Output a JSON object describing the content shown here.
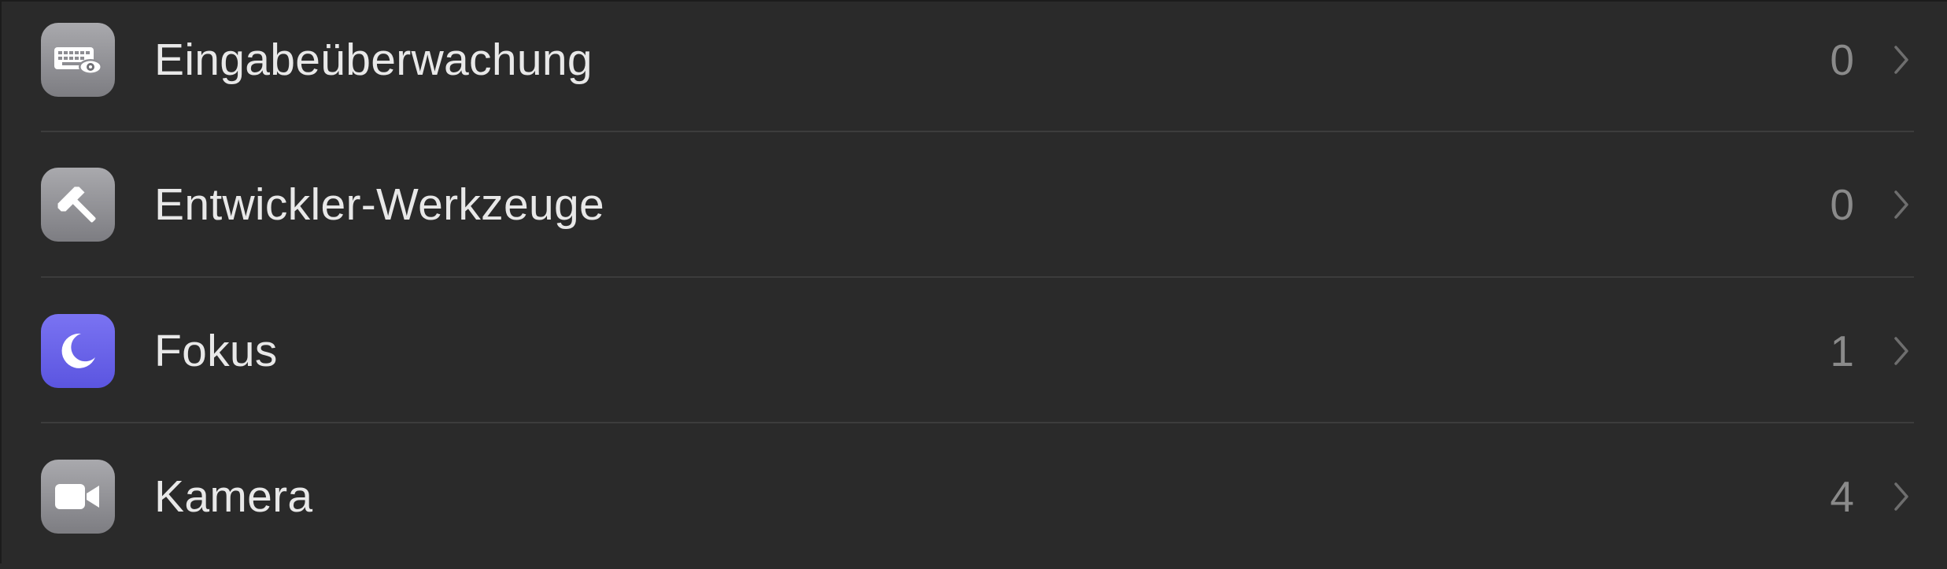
{
  "rows": [
    {
      "label": "Eingabeüberwachung",
      "count": "0",
      "icon": "keyboard-eye-icon",
      "icon_color": "#8e8e93"
    },
    {
      "label": "Entwickler-Werkzeuge",
      "count": "0",
      "icon": "hammer-icon",
      "icon_color": "#8e8e93"
    },
    {
      "label": "Fokus",
      "count": "1",
      "icon": "moon-icon",
      "icon_color": "#6760ea"
    },
    {
      "label": "Kamera",
      "count": "4",
      "icon": "video-camera-icon",
      "icon_color": "#8e8e93"
    }
  ],
  "colors": {
    "background": "#2a2a2a",
    "label": "#e8e8e8",
    "count": "#8a8a8a",
    "divider": "#3c3c3c"
  }
}
